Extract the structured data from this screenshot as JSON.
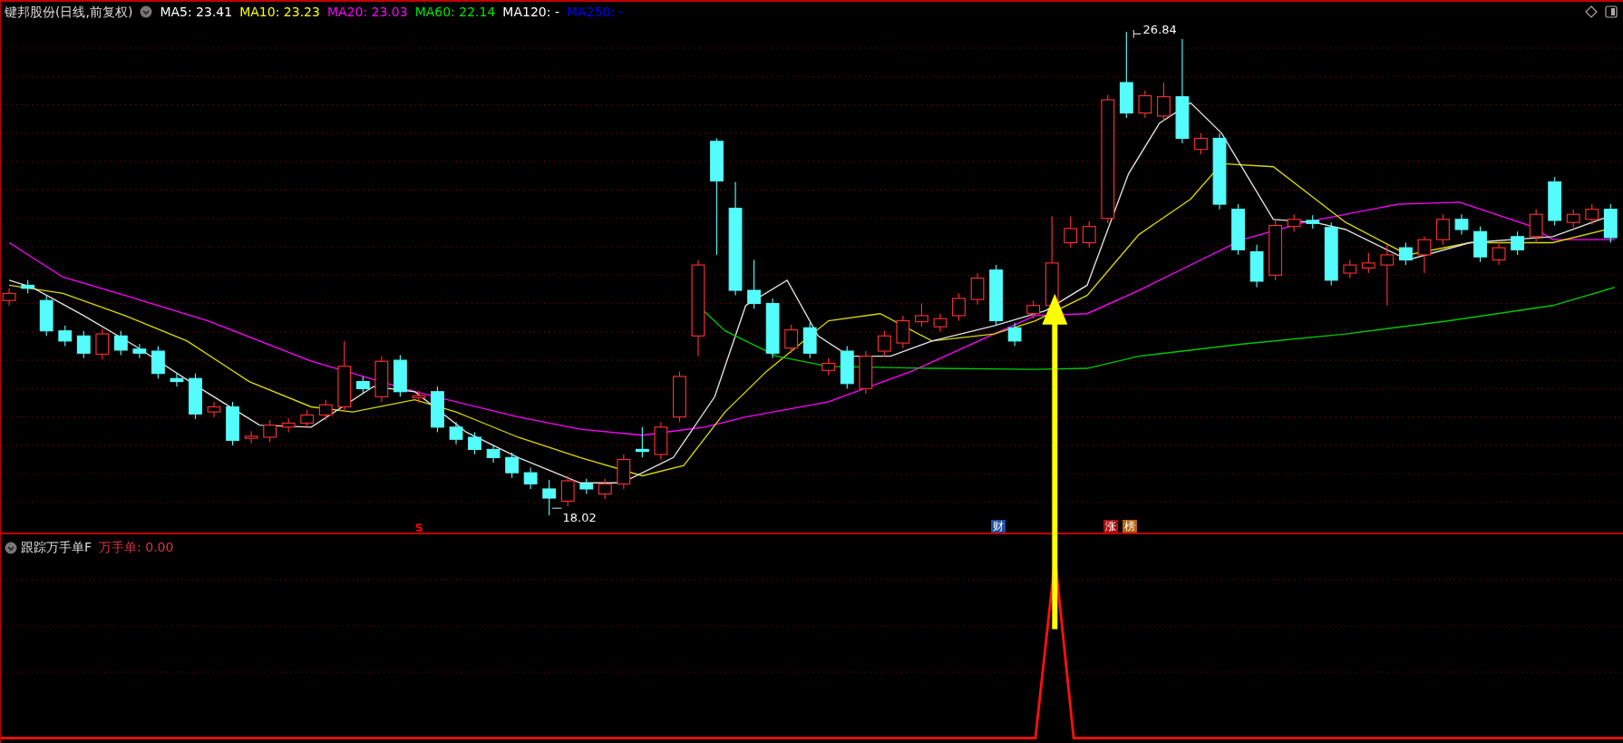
{
  "header": {
    "title": "键邦股份(日线,前复权)",
    "moving_averages": [
      {
        "label": "MA5:",
        "value": "23.41",
        "color": "#ffffff"
      },
      {
        "label": "MA10:",
        "value": "23.23",
        "color": "#ffff00"
      },
      {
        "label": "MA20:",
        "value": "23.03",
        "color": "#ff00ff"
      },
      {
        "label": "MA60:",
        "value": "22.14",
        "color": "#00e600"
      },
      {
        "label": "MA120:",
        "value": "-",
        "color": "#ffffff"
      },
      {
        "label": "MA250:",
        "value": "-",
        "color": "#0000ff"
      }
    ]
  },
  "chart": {
    "high_label": "26.84",
    "low_label": "18.02",
    "markers": [
      {
        "text": "S",
        "kind": "text",
        "color": "#ff0000"
      },
      {
        "text": "财",
        "kind": "tag",
        "color": "#1f4fa0"
      },
      {
        "text": "涨",
        "kind": "tag",
        "color": "#a81010"
      },
      {
        "text": "榜",
        "kind": "tag",
        "color": "#b8600c"
      }
    ]
  },
  "indicator": {
    "name": "跟踪万手单F",
    "readout": "万手单: 0.00"
  }
}
